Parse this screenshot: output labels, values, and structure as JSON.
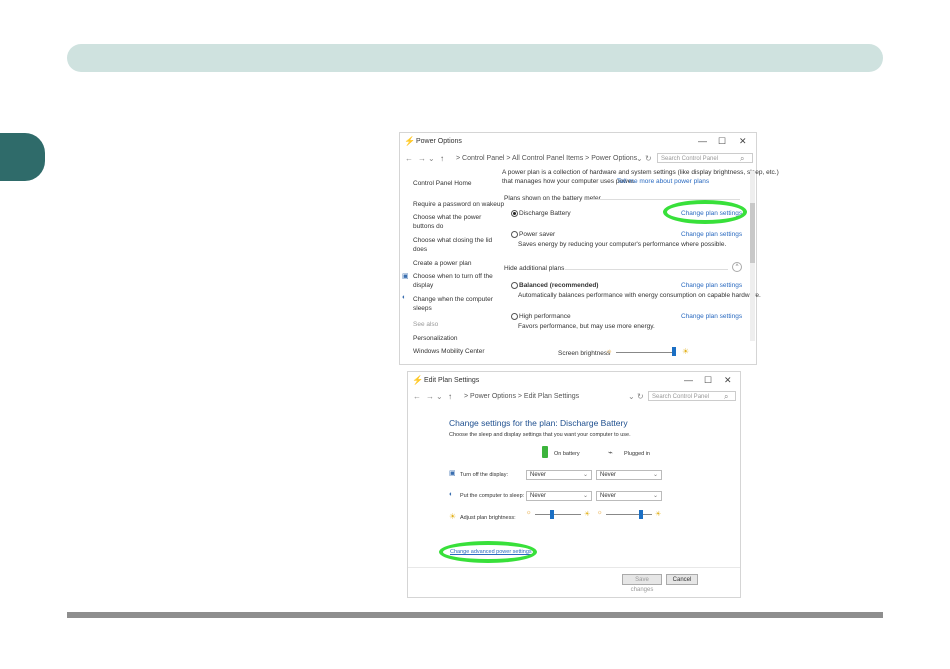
{
  "win1": {
    "title": "Power Options",
    "minimize": "—",
    "maximize": "☐",
    "close": "✕",
    "address": "> Control Panel  >  All Control Panel Items  >  Power Options",
    "search_placeholder": "Search Control Panel",
    "intro_line1": "A power plan is a collection of hardware and system settings (like display brightness, sleep, etc.)",
    "intro_line2": "that manages how your computer uses power.",
    "intro_link": "Tell me more about power plans",
    "sidebar": [
      {
        "label": "Control Panel Home"
      },
      {
        "label": "Require a password on wakeup"
      },
      {
        "label": "Choose what the power"
      },
      {
        "label": "buttons do"
      },
      {
        "label": "Choose what closing the lid"
      },
      {
        "label": "does"
      },
      {
        "label": "Create a power plan"
      },
      {
        "label": "Choose when to turn off the"
      },
      {
        "label": "display"
      },
      {
        "label": "Change when the computer"
      },
      {
        "label": "sleeps"
      },
      {
        "label": "See also"
      },
      {
        "label": "Personalization"
      },
      {
        "label": "Windows Mobility Center"
      }
    ],
    "section_battery": "Plans shown on the battery meter",
    "section_additional": "Hide additional plans",
    "change_link": "Change plan settings",
    "plans": [
      {
        "name": "Discharge Battery",
        "desc": ""
      },
      {
        "name": "Power saver",
        "desc": "Saves energy by reducing your computer's performance where possible."
      },
      {
        "name": "Balanced (recommended)",
        "desc": "Automatically balances performance with energy consumption on capable hardware."
      },
      {
        "name": "High performance",
        "desc": "Favors performance, but may use more energy."
      }
    ],
    "brightness_label": "Screen brightness"
  },
  "win2": {
    "title": "Edit Plan Settings",
    "minimize": "—",
    "maximize": "☐",
    "close": "✕",
    "address": "> Power Options  >  Edit Plan Settings",
    "search_placeholder": "Search Control Panel",
    "heading": "Change settings for the plan: Discharge Battery",
    "subheading": "Choose the sleep and display settings that you want your computer to use.",
    "col_battery": "On battery",
    "col_plugged": "Plugged in",
    "row_display": "Turn off the display:",
    "row_sleep": "Put the computer to sleep:",
    "row_brightness": "Adjust plan brightness:",
    "display_battery": "Never",
    "display_plugged": "Never",
    "sleep_battery": "Never",
    "sleep_plugged": "Never",
    "brightness_battery": 0.38,
    "brightness_plugged": 0.75,
    "advanced_link": "Change advanced power settings",
    "save_button": "Save changes",
    "cancel_button": "Cancel"
  },
  "colors": {
    "highlight": "#38e03a",
    "link": "#2a6ac0",
    "slider_knob": "#1b6fc4"
  }
}
